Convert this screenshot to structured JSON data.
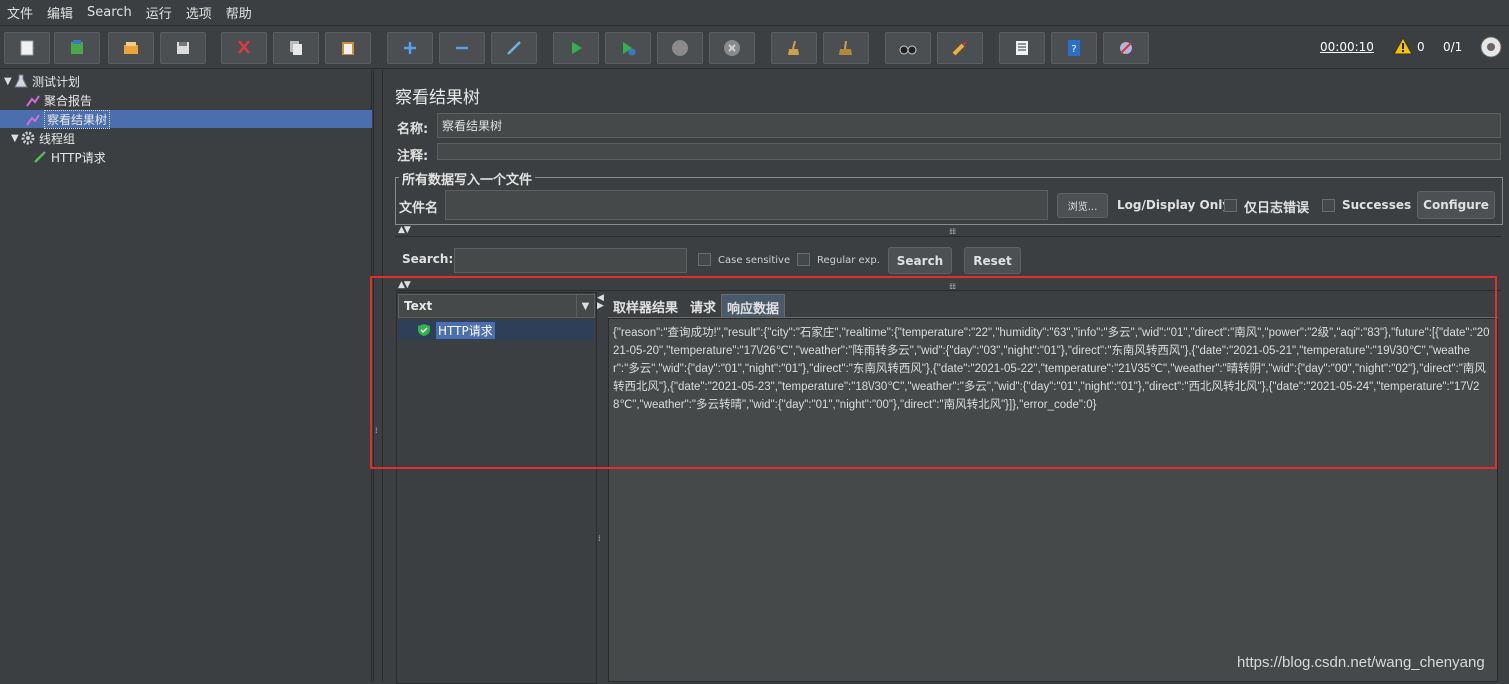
{
  "menu": [
    "文件",
    "编辑",
    "Search",
    "运行",
    "选项",
    "帮助"
  ],
  "toolbar": {
    "timer": "00:00:10",
    "warnings": "0",
    "threads": "0/1",
    "buttons": [
      "new-icon",
      "templates-icon",
      "open-icon",
      "save-icon",
      "cut-icon",
      "copy-icon",
      "paste-icon",
      "expand-icon",
      "collapse-icon",
      "toggle-icon",
      "start-icon",
      "start-no-pause-icon",
      "stop-icon",
      "shutdown-icon",
      "clear-icon",
      "clear-all-icon",
      "search-icon",
      "reset-search-icon",
      "function-helper-icon",
      "help-icon",
      "remote-icon"
    ]
  },
  "tree": {
    "items": [
      {
        "label": "测试计划"
      },
      {
        "label": "聚合报告"
      },
      {
        "label": "察看结果树"
      },
      {
        "label": "线程组"
      },
      {
        "label": "HTTP请求"
      }
    ]
  },
  "panel": {
    "title": "察看结果树",
    "name_label": "名称:",
    "name_value": "察看结果树",
    "comment_label": "注释:",
    "comment_value": "",
    "file_group_legend": "所有数据写入一个文件",
    "filename_label": "文件名",
    "filename_value": "",
    "browse_label": "浏览...",
    "log_display_label": "Log/Display Only:",
    "errors_only_label": "仅日志错误",
    "successes_label": "Successes",
    "configure_label": "Configure"
  },
  "search": {
    "label": "Search:",
    "value": "",
    "case_sensitive": "Case sensitive",
    "regular_exp": "Regular exp.",
    "search_button": "Search",
    "reset_button": "Reset"
  },
  "results": {
    "renderer": "Text",
    "sample_label": "HTTP请求",
    "tabs": [
      "取样器结果",
      "请求",
      "响应数据"
    ],
    "active_tab": "响应数据",
    "response_text": "{\"reason\":\"查询成功!\",\"result\":{\"city\":\"石家庄\",\"realtime\":{\"temperature\":\"22\",\"humidity\":\"63\",\"info\":\"多云\",\"wid\":\"01\",\"direct\":\"南风\",\"power\":\"2级\",\"aqi\":\"83\"},\"future\":[{\"date\":\"2021-05-20\",\"temperature\":\"17\\/26℃\",\"weather\":\"阵雨转多云\",\"wid\":{\"day\":\"03\",\"night\":\"01\"},\"direct\":\"东南风转西风\"},{\"date\":\"2021-05-21\",\"temperature\":\"19\\/30℃\",\"weather\":\"多云\",\"wid\":{\"day\":\"01\",\"night\":\"01\"},\"direct\":\"东南风转西风\"},{\"date\":\"2021-05-22\",\"temperature\":\"21\\/35℃\",\"weather\":\"晴转阴\",\"wid\":{\"day\":\"00\",\"night\":\"02\"},\"direct\":\"南风转西北风\"},{\"date\":\"2021-05-23\",\"temperature\":\"18\\/30℃\",\"weather\":\"多云\",\"wid\":{\"day\":\"01\",\"night\":\"01\"},\"direct\":\"西北风转北风\"},{\"date\":\"2021-05-24\",\"temperature\":\"17\\/28℃\",\"weather\":\"多云转晴\",\"wid\":{\"day\":\"01\",\"night\":\"00\"},\"direct\":\"南风转北风\"}]},\"error_code\":0}"
  },
  "watermark": "https://blog.csdn.net/wang_chenyang",
  "colors": {
    "highlight": "#e0302a",
    "selection": "#4b6eaf",
    "background": "#3c3f41"
  }
}
